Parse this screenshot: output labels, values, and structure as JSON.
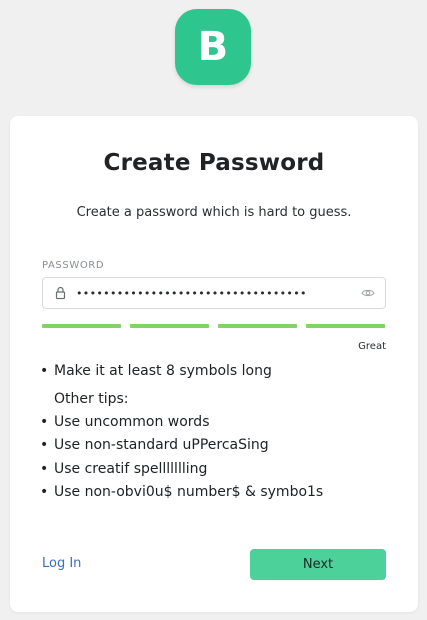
{
  "logo": {
    "letter": "B",
    "color": "#2ec58f"
  },
  "card": {
    "title": "Create Password",
    "subtitle": "Create a password which is hard to guess."
  },
  "password_field": {
    "label": "PASSWORD",
    "masked_value": "••••••••••••••••••••••••••••••••••",
    "icons": [
      "lock-icon",
      "eye-icon"
    ]
  },
  "strength": {
    "filled_segments": 4,
    "total_segments": 4,
    "label": "Great",
    "color": "#82d265"
  },
  "tips": {
    "primary": "Make it at least 8 symbols long",
    "heading": "Other tips:",
    "items": [
      "Use uncommon words",
      "Use non-standard uPPercaSing",
      "Use creatif spellllllling",
      "Use non-obvi0u$ number$ & symbo1s"
    ]
  },
  "actions": {
    "login_label": "Log In",
    "next_label": "Next",
    "accent_color": "#4cd19b",
    "link_color": "#3a6fbf"
  }
}
